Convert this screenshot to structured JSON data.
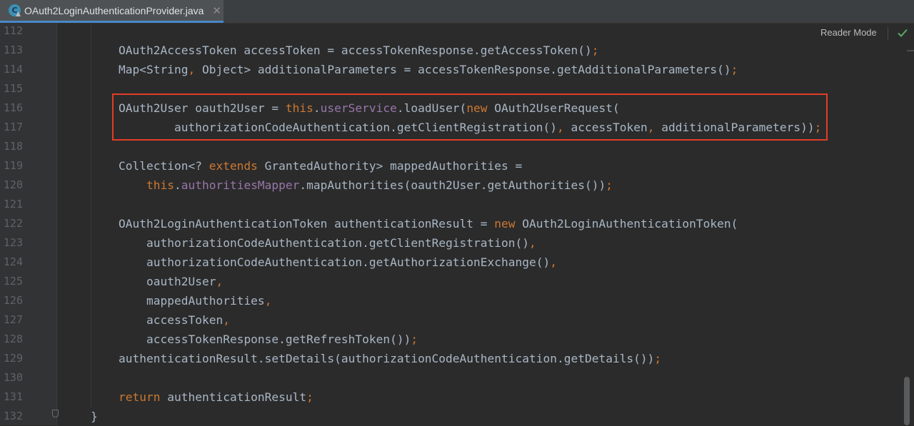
{
  "tab": {
    "icon": "java-class-icon",
    "icon_letter": "C",
    "title": "OAuth2LoginAuthenticationProvider.java",
    "close_glyph": "✕"
  },
  "reader_mode": {
    "label": "Reader Mode",
    "check_icon": "check-icon"
  },
  "colors": {
    "background": "#2b2b2b",
    "text": "#a9b7c6",
    "keyword": "#cc7832",
    "field": "#9876aa",
    "line_number": "#606366",
    "highlight_border": "#e23d27"
  },
  "editor": {
    "lines": [
      {
        "num": "112",
        "indent": 0,
        "tokens": []
      },
      {
        "num": "113",
        "indent": 2,
        "tokens": [
          {
            "t": "OAuth2AccessToken accessToken = accessTokenResponse.getAccessToken()",
            "c": "p"
          },
          {
            "t": ";",
            "c": "kw"
          }
        ]
      },
      {
        "num": "114",
        "indent": 2,
        "tokens": [
          {
            "t": "Map<String",
            "c": "p"
          },
          {
            "t": ",",
            "c": "kw"
          },
          {
            "t": " Object> additionalParameters = accessTokenResponse.getAdditionalParameters()",
            "c": "p"
          },
          {
            "t": ";",
            "c": "kw"
          }
        ]
      },
      {
        "num": "115",
        "indent": 0,
        "tokens": []
      },
      {
        "num": "116",
        "indent": 2,
        "tokens": [
          {
            "t": "OAuth2User oauth2User = ",
            "c": "p"
          },
          {
            "t": "this",
            "c": "kw"
          },
          {
            "t": ".",
            "c": "p"
          },
          {
            "t": "userService",
            "c": "field"
          },
          {
            "t": ".loadUser(",
            "c": "p"
          },
          {
            "t": "new ",
            "c": "kw"
          },
          {
            "t": "OAuth2UserRequest(",
            "c": "p"
          }
        ]
      },
      {
        "num": "117",
        "indent": 4,
        "tokens": [
          {
            "t": "authorizationCodeAuthentication.getClientRegistration()",
            "c": "p"
          },
          {
            "t": ",",
            "c": "kw"
          },
          {
            "t": " accessToken",
            "c": "p"
          },
          {
            "t": ",",
            "c": "kw"
          },
          {
            "t": " additionalParameters))",
            "c": "p"
          },
          {
            "t": ";",
            "c": "kw"
          }
        ]
      },
      {
        "num": "118",
        "indent": 0,
        "tokens": []
      },
      {
        "num": "119",
        "indent": 2,
        "tokens": [
          {
            "t": "Collection<? ",
            "c": "p"
          },
          {
            "t": "extends ",
            "c": "kw"
          },
          {
            "t": "GrantedAuthority> mappedAuthorities =",
            "c": "p"
          }
        ]
      },
      {
        "num": "120",
        "indent": 3,
        "tokens": [
          {
            "t": "this",
            "c": "kw"
          },
          {
            "t": ".",
            "c": "p"
          },
          {
            "t": "authoritiesMapper",
            "c": "field"
          },
          {
            "t": ".mapAuthorities(oauth2User.getAuthorities())",
            "c": "p"
          },
          {
            "t": ";",
            "c": "kw"
          }
        ]
      },
      {
        "num": "121",
        "indent": 0,
        "tokens": []
      },
      {
        "num": "122",
        "indent": 2,
        "tokens": [
          {
            "t": "OAuth2LoginAuthenticationToken authenticationResult = ",
            "c": "p"
          },
          {
            "t": "new ",
            "c": "kw"
          },
          {
            "t": "OAuth2LoginAuthenticationToken(",
            "c": "p"
          }
        ]
      },
      {
        "num": "123",
        "indent": 3,
        "tokens": [
          {
            "t": "authorizationCodeAuthentication.getClientRegistration()",
            "c": "p"
          },
          {
            "t": ",",
            "c": "kw"
          }
        ]
      },
      {
        "num": "124",
        "indent": 3,
        "tokens": [
          {
            "t": "authorizationCodeAuthentication.getAuthorizationExchange()",
            "c": "p"
          },
          {
            "t": ",",
            "c": "kw"
          }
        ]
      },
      {
        "num": "125",
        "indent": 3,
        "tokens": [
          {
            "t": "oauth2User",
            "c": "p"
          },
          {
            "t": ",",
            "c": "kw"
          }
        ]
      },
      {
        "num": "126",
        "indent": 3,
        "tokens": [
          {
            "t": "mappedAuthorities",
            "c": "p"
          },
          {
            "t": ",",
            "c": "kw"
          }
        ]
      },
      {
        "num": "127",
        "indent": 3,
        "tokens": [
          {
            "t": "accessToken",
            "c": "p"
          },
          {
            "t": ",",
            "c": "kw"
          }
        ]
      },
      {
        "num": "128",
        "indent": 3,
        "tokens": [
          {
            "t": "accessTokenResponse.getRefreshToken())",
            "c": "p"
          },
          {
            "t": ";",
            "c": "kw"
          }
        ]
      },
      {
        "num": "129",
        "indent": 2,
        "tokens": [
          {
            "t": "authenticationResult.setDetails(authorizationCodeAuthentication.getDetails())",
            "c": "p"
          },
          {
            "t": ";",
            "c": "kw"
          }
        ]
      },
      {
        "num": "130",
        "indent": 0,
        "tokens": []
      },
      {
        "num": "131",
        "indent": 2,
        "tokens": [
          {
            "t": "return ",
            "c": "kw"
          },
          {
            "t": "authenticationResult",
            "c": "p"
          },
          {
            "t": ";",
            "c": "kw"
          }
        ]
      },
      {
        "num": "132",
        "indent": 1,
        "tokens": [
          {
            "t": "}",
            "c": "p"
          }
        ]
      }
    ]
  }
}
